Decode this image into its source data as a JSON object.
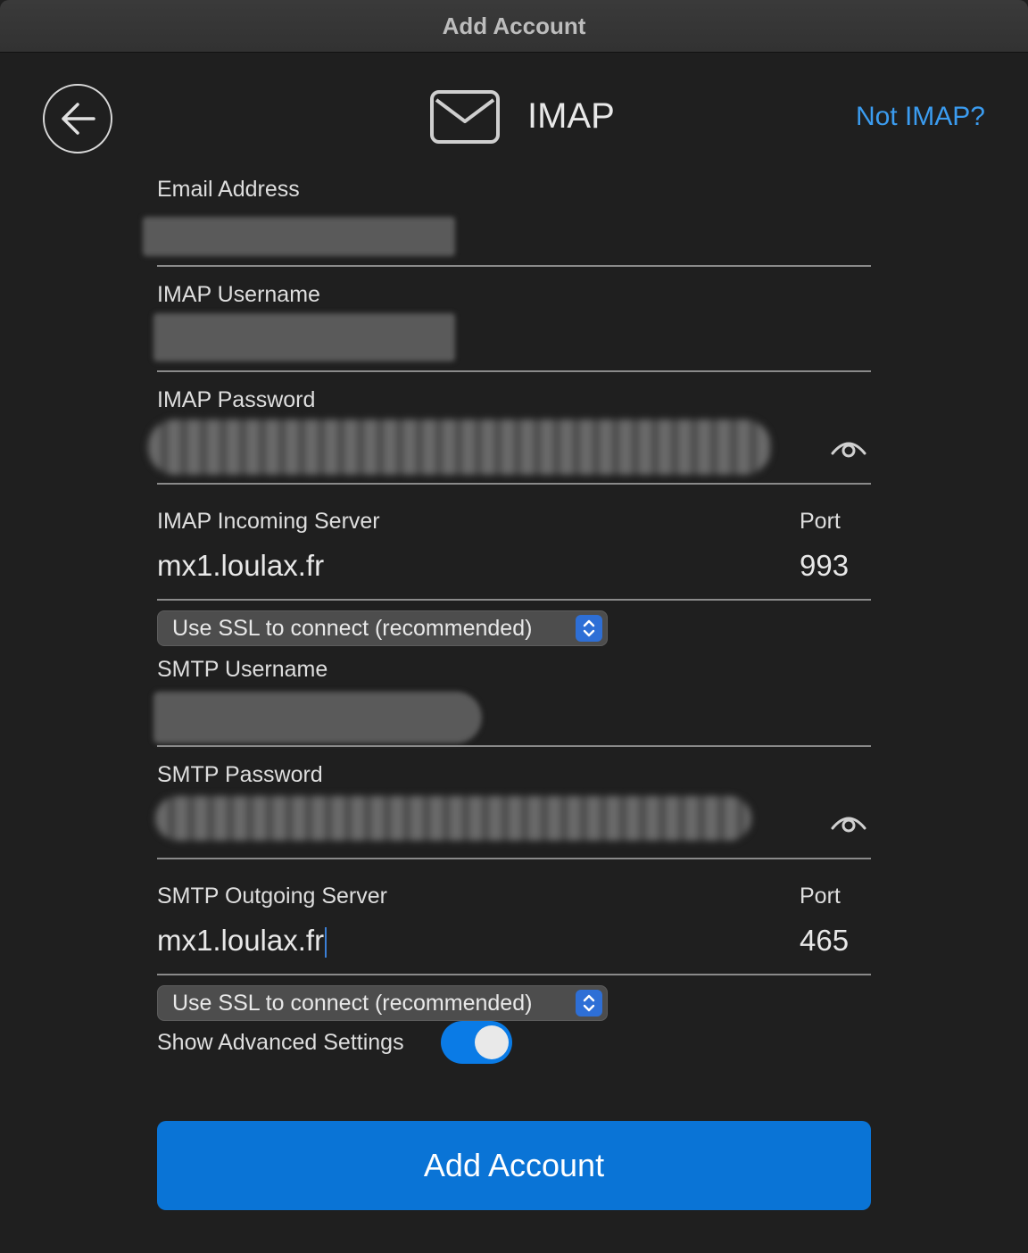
{
  "window": {
    "title": "Add Account"
  },
  "header": {
    "icon": "mail-icon",
    "title": "IMAP",
    "not_imap_link": "Not IMAP?",
    "back_icon": "back-arrow-icon"
  },
  "form": {
    "email_label": "Email Address",
    "imap_username_label": "IMAP Username",
    "imap_password_label": "IMAP Password",
    "imap_server_label": "IMAP Incoming Server",
    "imap_port_label": "Port",
    "imap_server_value": "mx1.loulax.fr",
    "imap_port_value": "993",
    "imap_ssl_option": "Use SSL to connect (recommended)",
    "smtp_username_label": "SMTP Username",
    "smtp_password_label": "SMTP Password",
    "smtp_server_label": "SMTP Outgoing Server",
    "smtp_port_label": "Port",
    "smtp_server_value": "mx1.loulax.fr",
    "smtp_port_value": "465",
    "smtp_ssl_option": "Use SSL to connect (recommended)",
    "advanced_label": "Show Advanced Settings",
    "advanced_enabled": true
  },
  "actions": {
    "add_account_label": "Add Account"
  },
  "colors": {
    "accent": "#0a74d6",
    "link": "#3b9cf0",
    "background": "#1f1f1f"
  }
}
